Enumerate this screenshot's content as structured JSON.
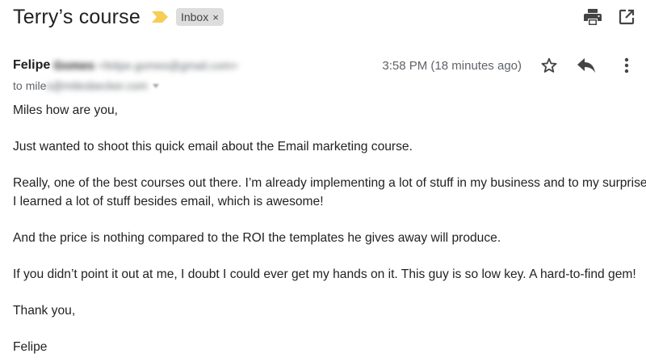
{
  "email": {
    "subject": "Terry’s course",
    "label": "Inbox",
    "label_remove_glyph": "×",
    "sender_name": "Felipe",
    "sender_surname_blurred": "Gomes",
    "sender_email_blurred": "<felipe.gomes@gmail.com>",
    "timestamp": "3:58 PM (18 minutes ago)",
    "to_label": "to",
    "recipient_visible": "mile",
    "recipient_blurred": "s@milesbecker.com",
    "body": {
      "greeting": "Miles how are you,",
      "p1": "Just wanted to shoot this quick email about the Email marketing course.",
      "p2_line1": "Really, one of the best courses out there. I’m already implementing a lot of stuff in my business and to my surprise,",
      "p2_line2": "I learned a lot of stuff besides email, which is awesome!",
      "p3": "And the price is nothing compared to the ROI the templates he gives away will produce.",
      "p4": "If you didn’t point it out at me, I doubt I could ever get my hands on it. This guy is so low key. A hard-to-find gem!",
      "signoff": "Thank you,",
      "signature": "Felipe"
    }
  },
  "icons": {
    "importance": "importance-marker-icon",
    "print": "print-icon",
    "open_new_window": "open-in-new-window-icon",
    "star": "star-icon",
    "reply": "reply-icon",
    "more": "more-vertical-icon"
  },
  "colors": {
    "importance_marker": "#f6cd55",
    "label_chip_bg": "#dddddd",
    "icon_gray": "#444444",
    "timestamp_gray": "#5f6368"
  }
}
